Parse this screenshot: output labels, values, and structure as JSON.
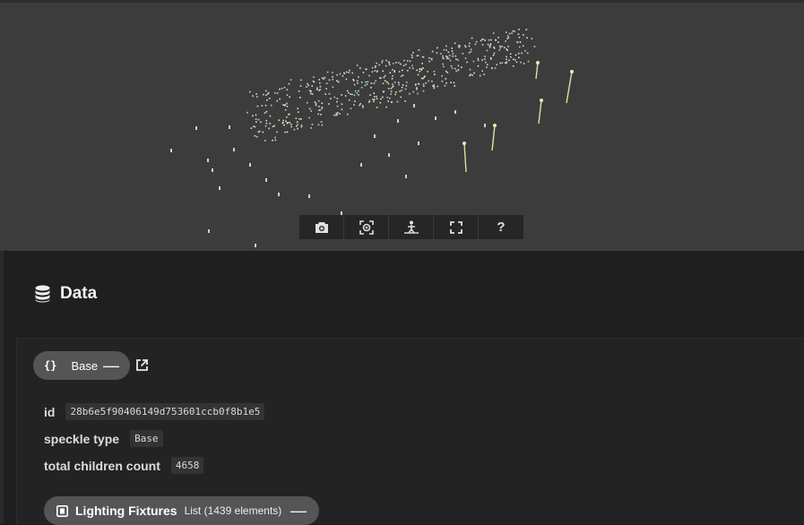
{
  "viewer": {
    "toolbar": [
      {
        "name": "screenshot-button",
        "icon": "camera-icon"
      },
      {
        "name": "zoom-extents-button",
        "icon": "focus-icon"
      },
      {
        "name": "view-mode-button",
        "icon": "person-icon"
      },
      {
        "name": "fullscreen-button",
        "icon": "fullscreen-icon"
      },
      {
        "name": "help-button",
        "icon": "help-icon",
        "label": "?"
      }
    ]
  },
  "data_panel": {
    "title": "Data",
    "title_icon": "database-icon",
    "base": {
      "braces": "{}",
      "label": "Base",
      "collapse": "—",
      "open_icon": "open-in-new-icon"
    },
    "fields": [
      {
        "label": "id",
        "value": "28b6e5f90406149d753601ccb0f8b1e5"
      },
      {
        "label": "speckle type",
        "value": "Base"
      },
      {
        "label": "total children count",
        "value": "4658"
      }
    ],
    "lighting": {
      "icon": "list-icon",
      "label": "Lighting Fixtures",
      "sub": "List (1439 elements)",
      "collapse": "—"
    }
  },
  "colors": {
    "viewer_bg": "#3c3c3c",
    "panel_bg": "#1f1f1f",
    "chip_bg": "#555555",
    "value_bg": "#333333"
  }
}
